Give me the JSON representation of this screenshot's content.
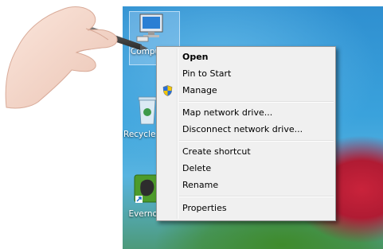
{
  "desktop": {
    "icons": [
      {
        "label": "Computer",
        "icon": "computer-icon"
      },
      {
        "label": "Recycle Bin",
        "icon": "recycle-bin-icon"
      },
      {
        "label": "Evernote",
        "icon": "evernote-icon"
      }
    ]
  },
  "context_menu": {
    "items": [
      {
        "label": "Open",
        "bold": true
      },
      {
        "label": "Pin to Start"
      },
      {
        "label": "Manage",
        "icon": "uac-shield-icon"
      },
      {
        "label": "Map network drive..."
      },
      {
        "label": "Disconnect network drive..."
      },
      {
        "label": "Create shortcut"
      },
      {
        "label": "Delete"
      },
      {
        "label": "Rename"
      },
      {
        "label": "Properties"
      }
    ]
  },
  "colors": {
    "menu_bg": "#f0f0f0",
    "menu_border": "#979797",
    "desktop_sky": "#2f8fd0"
  }
}
